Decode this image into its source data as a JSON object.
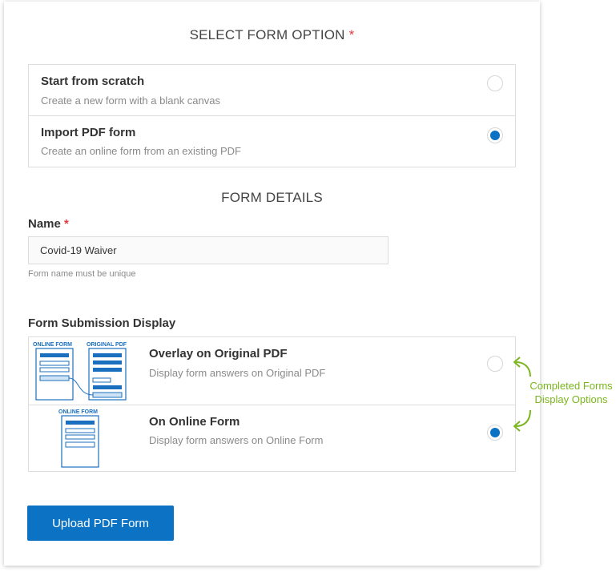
{
  "select_form_option": {
    "title": "SELECT FORM OPTION",
    "required_mark": "*",
    "options": [
      {
        "title": "Start from scratch",
        "description": "Create a new form with a blank canvas",
        "selected": false
      },
      {
        "title": "Import PDF form",
        "description": "Create an online form from an existing PDF",
        "selected": true
      }
    ]
  },
  "form_details": {
    "title": "FORM DETAILS",
    "name_label": "Name",
    "required_mark": "*",
    "name_value": "Covid-19 Waiver",
    "name_helper": "Form name must be unique"
  },
  "submission_display": {
    "label": "Form Submission Display",
    "options": [
      {
        "title": "Overlay on Original PDF",
        "description": "Display form answers on Original PDF",
        "selected": false,
        "thumb_labels": [
          "ONLINE FORM",
          "ORIGINAL PDF"
        ]
      },
      {
        "title": "On Online Form",
        "description": "Display form answers on Online Form",
        "selected": true,
        "thumb_labels": [
          "ONLINE FORM"
        ]
      }
    ]
  },
  "annotation": {
    "line1": "Completed Forms",
    "line2": "Display Options"
  },
  "upload_button": {
    "label": "Upload PDF Form"
  },
  "colors": {
    "accent": "#0b72c4",
    "required": "#e0393e",
    "annotation": "#7ab51d",
    "thumb_line": "#1a6fbf"
  },
  "icons": {
    "overlay_thumb": "form-overlay-diagram-icon",
    "online_thumb": "online-form-diagram-icon",
    "arrow": "curved-arrow-icon"
  }
}
